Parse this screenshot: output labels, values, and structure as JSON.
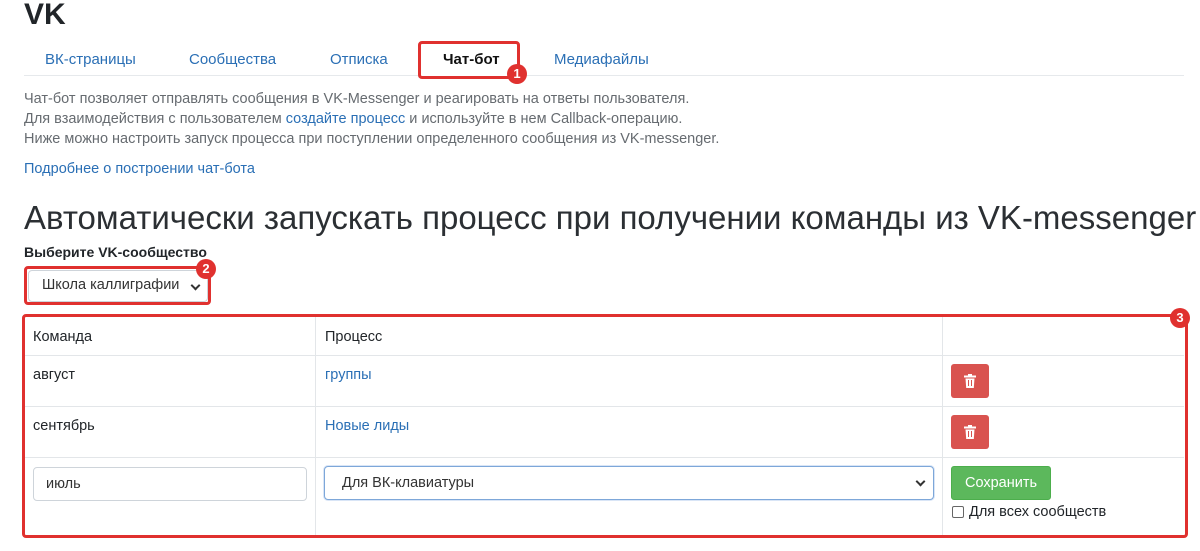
{
  "page": {
    "title": "VK"
  },
  "tabs": [
    {
      "label": "ВК-страницы"
    },
    {
      "label": "Сообщества"
    },
    {
      "label": "Отписка"
    },
    {
      "label": "Чат-бот",
      "active": true
    },
    {
      "label": "Медиафайлы"
    }
  ],
  "description": {
    "line1": "Чат-бот позволяет отправлять сообщения в VK-Messenger и реагировать на ответы пользователя.",
    "line2_before": "Для взаимодействия с пользователем ",
    "line2_link": "создайте процесс",
    "line2_after": " и используйте в нем Callback-операцию.",
    "line3": "Ниже можно настроить запуск процесса при поступлении определенного сообщения из VK-messenger."
  },
  "more_link": "Подробнее о построении чат-бота",
  "heading": "Автоматически запускать процесс при получении команды из VK-messenger",
  "community": {
    "label": "Выберите VK-сообщество",
    "selected": "Школа каллиграфии"
  },
  "table": {
    "headers": [
      "Команда",
      "Процесс",
      ""
    ],
    "rows": [
      {
        "command": "август",
        "process": "группы"
      },
      {
        "command": "сентябрь",
        "process": "Новые лиды"
      }
    ],
    "new_row": {
      "command_value": "июль",
      "process_selected": "Для ВК-клавиатуры",
      "save_label": "Сохранить",
      "all_communities_label": "Для всех сообществ"
    }
  },
  "annotations": {
    "badge1": "1",
    "badge2": "2",
    "badge3": "3",
    "color": "#e0312f"
  },
  "colors": {
    "link": "#2a6fb5",
    "delete_button": "#d9534f",
    "save_button": "#5cb85c"
  },
  "icons": {
    "delete": "trash-icon",
    "dropdown": "chevron-down-icon"
  }
}
